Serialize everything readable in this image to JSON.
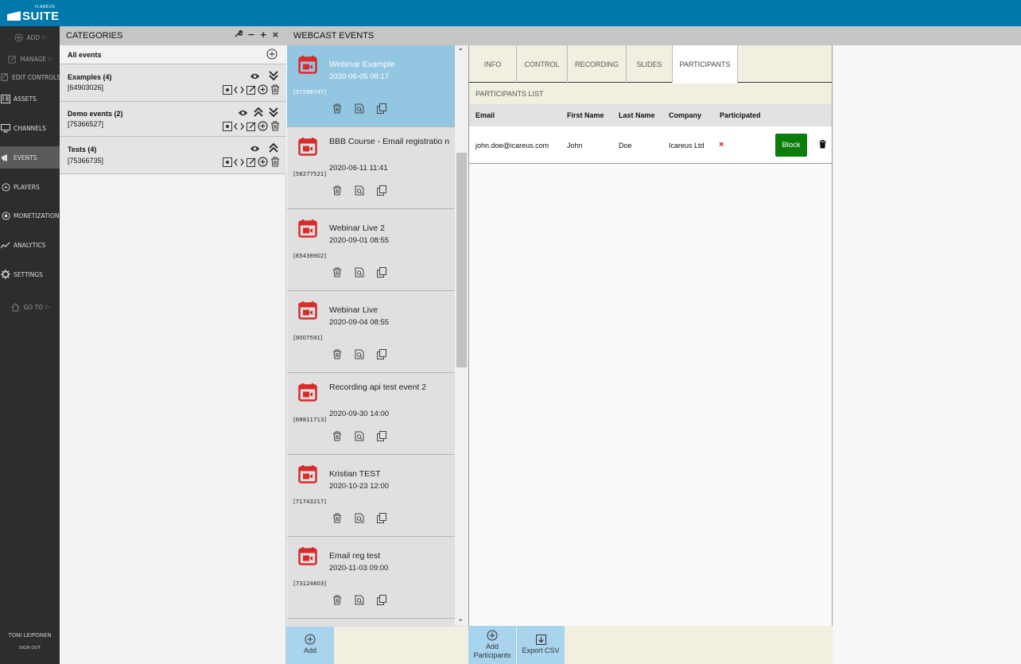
{
  "app": {
    "logo_small": "ICAREUS",
    "logo_big": "SUITE",
    "brand_color": "#0078ab"
  },
  "sidebar": {
    "add": "ADD",
    "manage": "MANAGE",
    "edit_controls": "EDIT CONTROLS",
    "items": [
      {
        "label": "ASSETS",
        "icon": "assets-icon"
      },
      {
        "label": "CHANNELS",
        "icon": "monitor-icon"
      },
      {
        "label": "EVENTS",
        "icon": "megaphone-icon",
        "active": true
      },
      {
        "label": "PLAYERS",
        "icon": "play-icon"
      },
      {
        "label": "MONETIZATION",
        "icon": "monetization-icon"
      },
      {
        "label": "ANALYTICS",
        "icon": "chart-line-icon"
      },
      {
        "label": "SETTINGS",
        "icon": "gear-icon"
      }
    ],
    "goto": "GO TO",
    "user": "TONI LEIPONEN",
    "signout": "SIGN OUT"
  },
  "categories": {
    "header": "CATEGORIES",
    "all_events": "All events",
    "rows": [
      {
        "name": "Examples (4)",
        "id": "[64903026]"
      },
      {
        "name": "Demo events (2)",
        "id": "[75366527]"
      },
      {
        "name": "Tests (4)",
        "id": "[75366735]"
      }
    ]
  },
  "events": {
    "header": "WEBCAST EVENTS",
    "items": [
      {
        "title": "Webinar Example",
        "date": "2020-06-05 08:17",
        "id": "[57596747]",
        "selected": true
      },
      {
        "title": "BBB Course - Email registratio n",
        "date": "2020-06-11 11:41",
        "id": "[58277521]"
      },
      {
        "title": "Webinar Live 2",
        "date": "2020-09-01 08:55",
        "id": "[65438902]"
      },
      {
        "title": "Webinar Live",
        "date": "2020-09-04 08:55",
        "id": "[9007591]"
      },
      {
        "title": "Recording api test event 2",
        "date": "2020-09-30 14:00",
        "id": "[68811713]"
      },
      {
        "title": "Kristian TEST",
        "date": "2020-10-23 12:00",
        "id": "[71743217]"
      },
      {
        "title": "Email reg test",
        "date": "2020-11-03 09:00",
        "id": "[73124803]"
      }
    ],
    "add_label": "Add"
  },
  "detail": {
    "tabs": [
      "INFO",
      "CONTROL",
      "RECORDING",
      "SLIDES",
      "PARTICIPANTS"
    ],
    "active_tab": "PARTICIPANTS",
    "list_title": "PARTICIPANTS LIST",
    "columns": [
      "Email",
      "First Name",
      "Last Name",
      "Company",
      "Participated"
    ],
    "rows": [
      {
        "email": "john.doe@icareus.com",
        "first": "John",
        "last": "Doe",
        "company": "Icareus Ltd",
        "participated": "×",
        "block": "Block"
      }
    ],
    "add_participants": "Add Participants",
    "export_csv": "Export CSV"
  }
}
